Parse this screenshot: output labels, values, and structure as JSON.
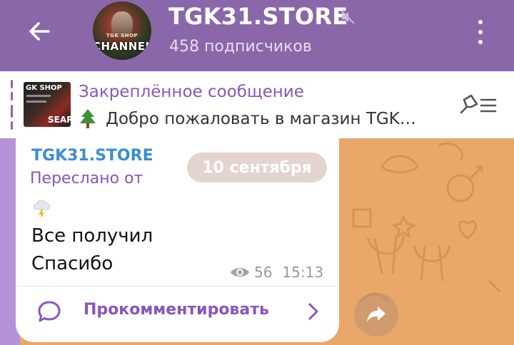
{
  "header": {
    "title": "TGK31.STORE",
    "subtitle": "458 подписчиков",
    "avatar_caption_top": "TGK SHOP",
    "avatar_caption_main": "CHANNEL",
    "back_icon": "arrow-left-icon",
    "mute_icon": "muted-speaker-icon",
    "menu_icon": "vertical-dots-icon"
  },
  "pinned": {
    "title": "Закреплённое сообщение",
    "text": "Добро пожаловать в магазин TGK…",
    "emoji_icon": "christmas-tree-icon",
    "thumb_caption_top": "GK SHOP",
    "thumb_caption_bottom": "SEAR",
    "list_icon": "pinned-list-icon"
  },
  "message": {
    "channel_name": "TGK31.STORE",
    "date_separator": "10 сентября",
    "forwarded_label": "Переслано от",
    "sender_icon": "cloud-lightning-icon",
    "lines": [
      "Все получил",
      "Спасибо"
    ],
    "views": "56",
    "time": "15:13",
    "comment_label": "Прокомментировать"
  },
  "colors": {
    "header_bg": "#8a67a8",
    "accent_purple": "#8a55b8",
    "channel_blue": "#3a8ed1",
    "chat_bg": "#e9a86a"
  }
}
